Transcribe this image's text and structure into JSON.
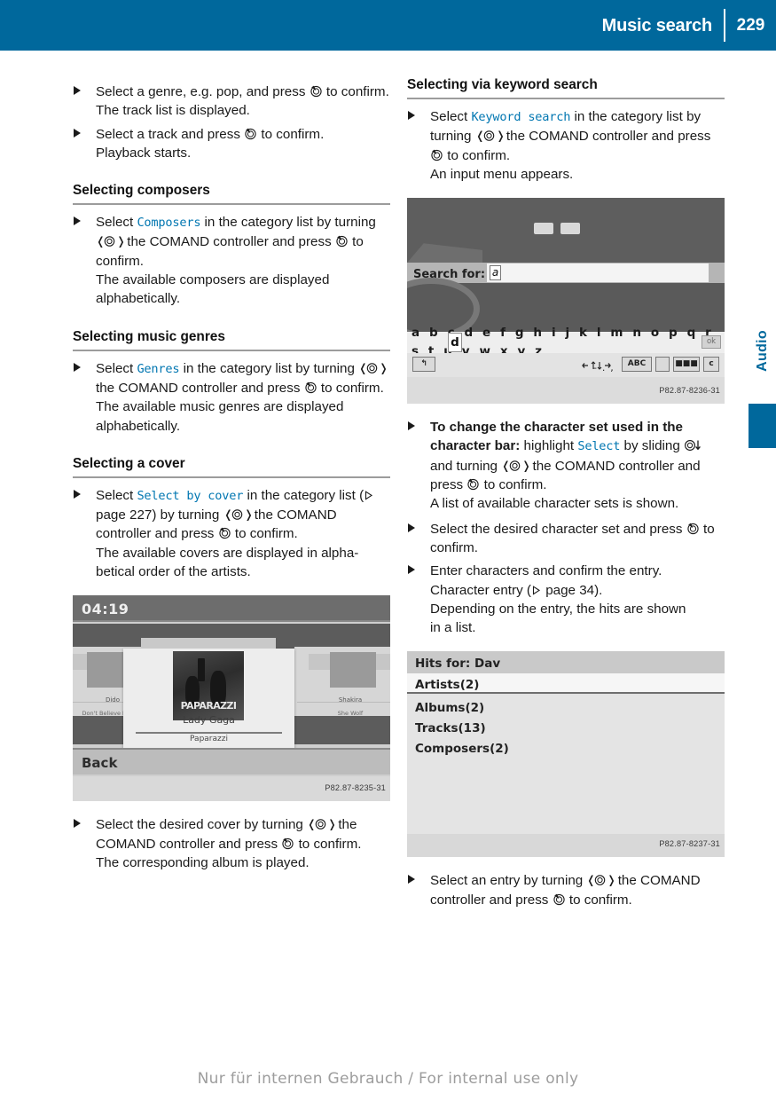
{
  "header": {
    "title": "Music search",
    "page_number": "229"
  },
  "side_tab": {
    "label": "Audio"
  },
  "footer": {
    "watermark": "Nur für internen Gebrauch / For internal use only"
  },
  "left_column": {
    "step_genre": {
      "text_before": "Select a genre, e.g. pop, and press",
      "text_after": "to confirm.",
      "result": "The track list is displayed."
    },
    "step_track": {
      "text_before": "Select a track and press",
      "text_after": "to confirm.",
      "result": "Playback starts."
    },
    "heading_composers": "Selecting composers",
    "step_composers": {
      "t1": "Select",
      "display": "Composers",
      "t2": "in the category list by turning",
      "t3": "the COMAND controller and press",
      "t4": "to confirm.",
      "result_line1": "The available composers are displayed",
      "result_line2": "alphabetically."
    },
    "heading_genres": "Selecting music genres",
    "step_genres": {
      "t1": "Select",
      "display": "Genres",
      "t2": "in the category list by turning",
      "t3": "the COMAND controller and press",
      "t4": "to confirm.",
      "result_line1": "The available music genres are displayed",
      "result_line2": "alphabetically."
    },
    "heading_cover": "Selecting a cover",
    "step_cover": {
      "t1": "Select",
      "display": "Select by cover",
      "t2": "in the category list (",
      "t3": "page 227) by turning",
      "t4": "the COMAND controller and press",
      "t5": "to confirm.",
      "result_line1": "The available covers are displayed in alpha-",
      "result_line2": "betical order of the artists."
    },
    "figure_cover": {
      "time": "04:19",
      "artist": "Lady Gaga",
      "track": "Paparazzi",
      "album_art_title": "PAPARAZZI",
      "left_cover_title": "Dido",
      "left_cover_artist": "Dido",
      "left_cover_track": "Don't Believe In Love",
      "right_cover_artist": "Shakira",
      "right_cover_track": "She Wolf",
      "back_label": "Back",
      "caption": "P82.87-8235-31"
    },
    "step_select_cover": {
      "t1": "Select the desired cover by turning",
      "t2": "the COMAND controller and press",
      "t3": "to confirm.",
      "result": "The corresponding album is played."
    }
  },
  "right_column": {
    "heading_keyword": "Selecting via keyword search",
    "step_keyword": {
      "t1": "Select",
      "display": "Keyword search",
      "t2": "in the category list by turning",
      "t3": "the COMAND controller and press",
      "t4": "to confirm.",
      "result": "An input menu appears."
    },
    "figure_input": {
      "search_label": "Search for:",
      "search_value": "a",
      "character_bar": "a b c d e f g h i j k l m n o p q r s t u v w x y z _",
      "selected_char": "d",
      "ok_label": "ok",
      "back_button": "↰",
      "symbols": "- . ,",
      "abc_label": "ABC",
      "blank_label": "",
      "glyph_label": "■■■",
      "c_label": "c",
      "caption": "P82.87-8236-31"
    },
    "step_charset": {
      "bold_t1": "To change the character set used in the character bar:",
      "t2": "highlight",
      "display": "Select",
      "t3": "by sliding",
      "t4": "and turning",
      "t5": "the COMAND controller and press",
      "t6": "to confirm.",
      "result": "A list of available character sets is shown."
    },
    "step_desired_charset": {
      "t1": "Select the desired character set and press",
      "t2": "to confirm."
    },
    "step_enter_chars": {
      "t1": "Enter characters and confirm the entry.",
      "t2": "Character entry (",
      "t3": "page 34).",
      "result_line1": "Depending on the entry, the hits are shown",
      "result_line2": "in a list."
    },
    "figure_hits": {
      "header": "Hits for: Dav",
      "rows": [
        "Artists(2)",
        "Albums(2)",
        "Tracks(13)",
        "Composers(2)"
      ],
      "caption": "P82.87-8237-31"
    },
    "step_select_entry": {
      "t1": "Select an entry by turning",
      "t2": "the COMAND controller and press",
      "t3": "to confirm."
    }
  }
}
